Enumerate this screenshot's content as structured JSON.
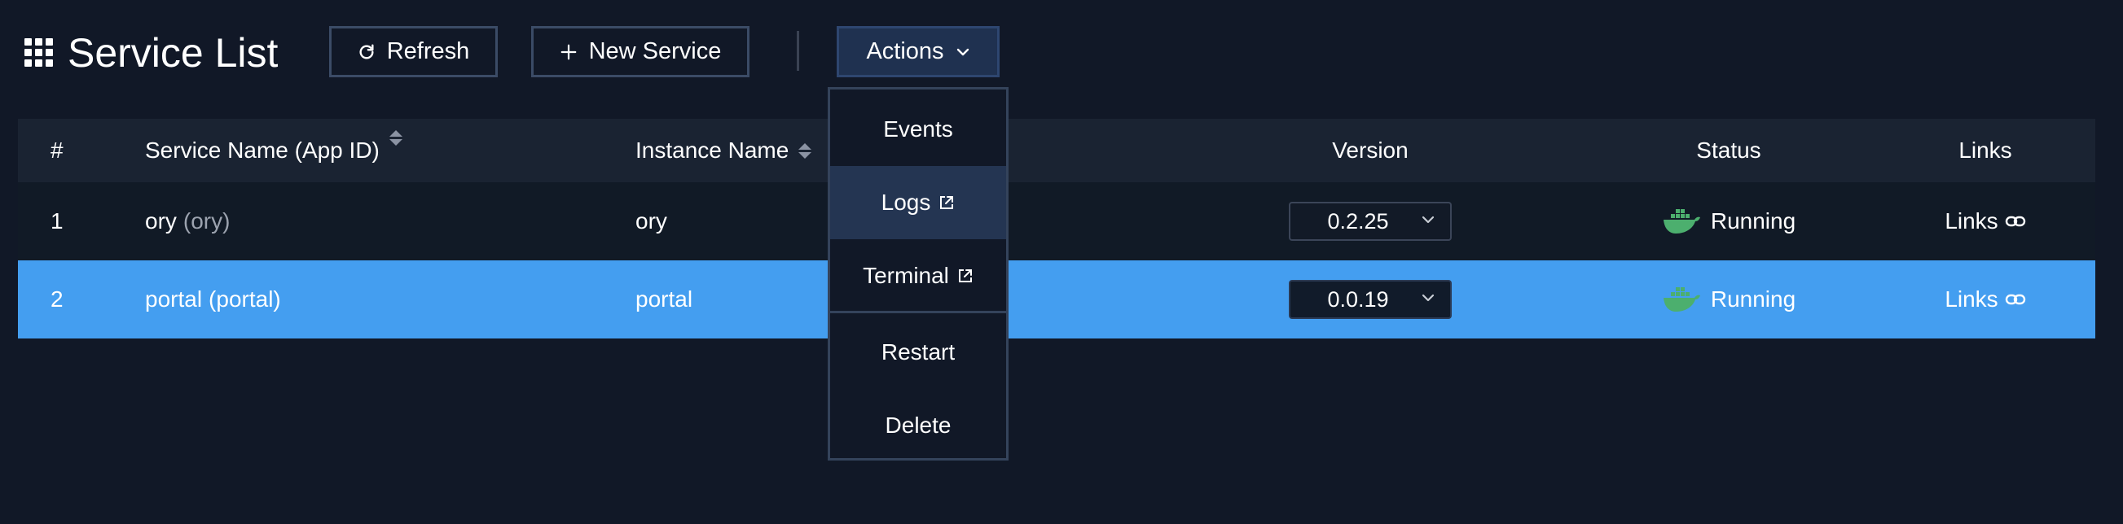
{
  "header": {
    "title": "Service List",
    "refresh_label": "Refresh",
    "new_service_label": "New Service",
    "actions_label": "Actions"
  },
  "icons": {
    "app": "grid-icon",
    "refresh": "refresh-icon",
    "new": "plus-icon",
    "actions": "chevron-down-icon",
    "sort": "sort-icon",
    "docker": "docker-icon",
    "link": "link-icon",
    "external": "external-link-icon"
  },
  "table": {
    "columns": {
      "num": "#",
      "name": "Service Name (App ID)",
      "instance": "Instance Name",
      "version": "Version",
      "status": "Status",
      "links": "Links"
    },
    "rows": [
      {
        "num": "1",
        "name": "ory",
        "app_id": "(ory)",
        "instance": "ory",
        "version": "0.2.25",
        "status": "Running",
        "links": "Links"
      },
      {
        "num": "2",
        "name": "portal",
        "app_id": "(portal)",
        "instance": "portal",
        "version": "0.0.19",
        "status": "Running",
        "links": "Links"
      }
    ]
  },
  "actions_menu": {
    "items": [
      {
        "label": "Events"
      },
      {
        "label": "Logs"
      },
      {
        "label": "Terminal"
      },
      {
        "label": "Restart"
      },
      {
        "label": "Delete"
      }
    ]
  },
  "colors": {
    "background": "#111827",
    "selected_row": "#449ef0",
    "docker_green": "#4caf6e",
    "button_border": "#3b4b66"
  }
}
